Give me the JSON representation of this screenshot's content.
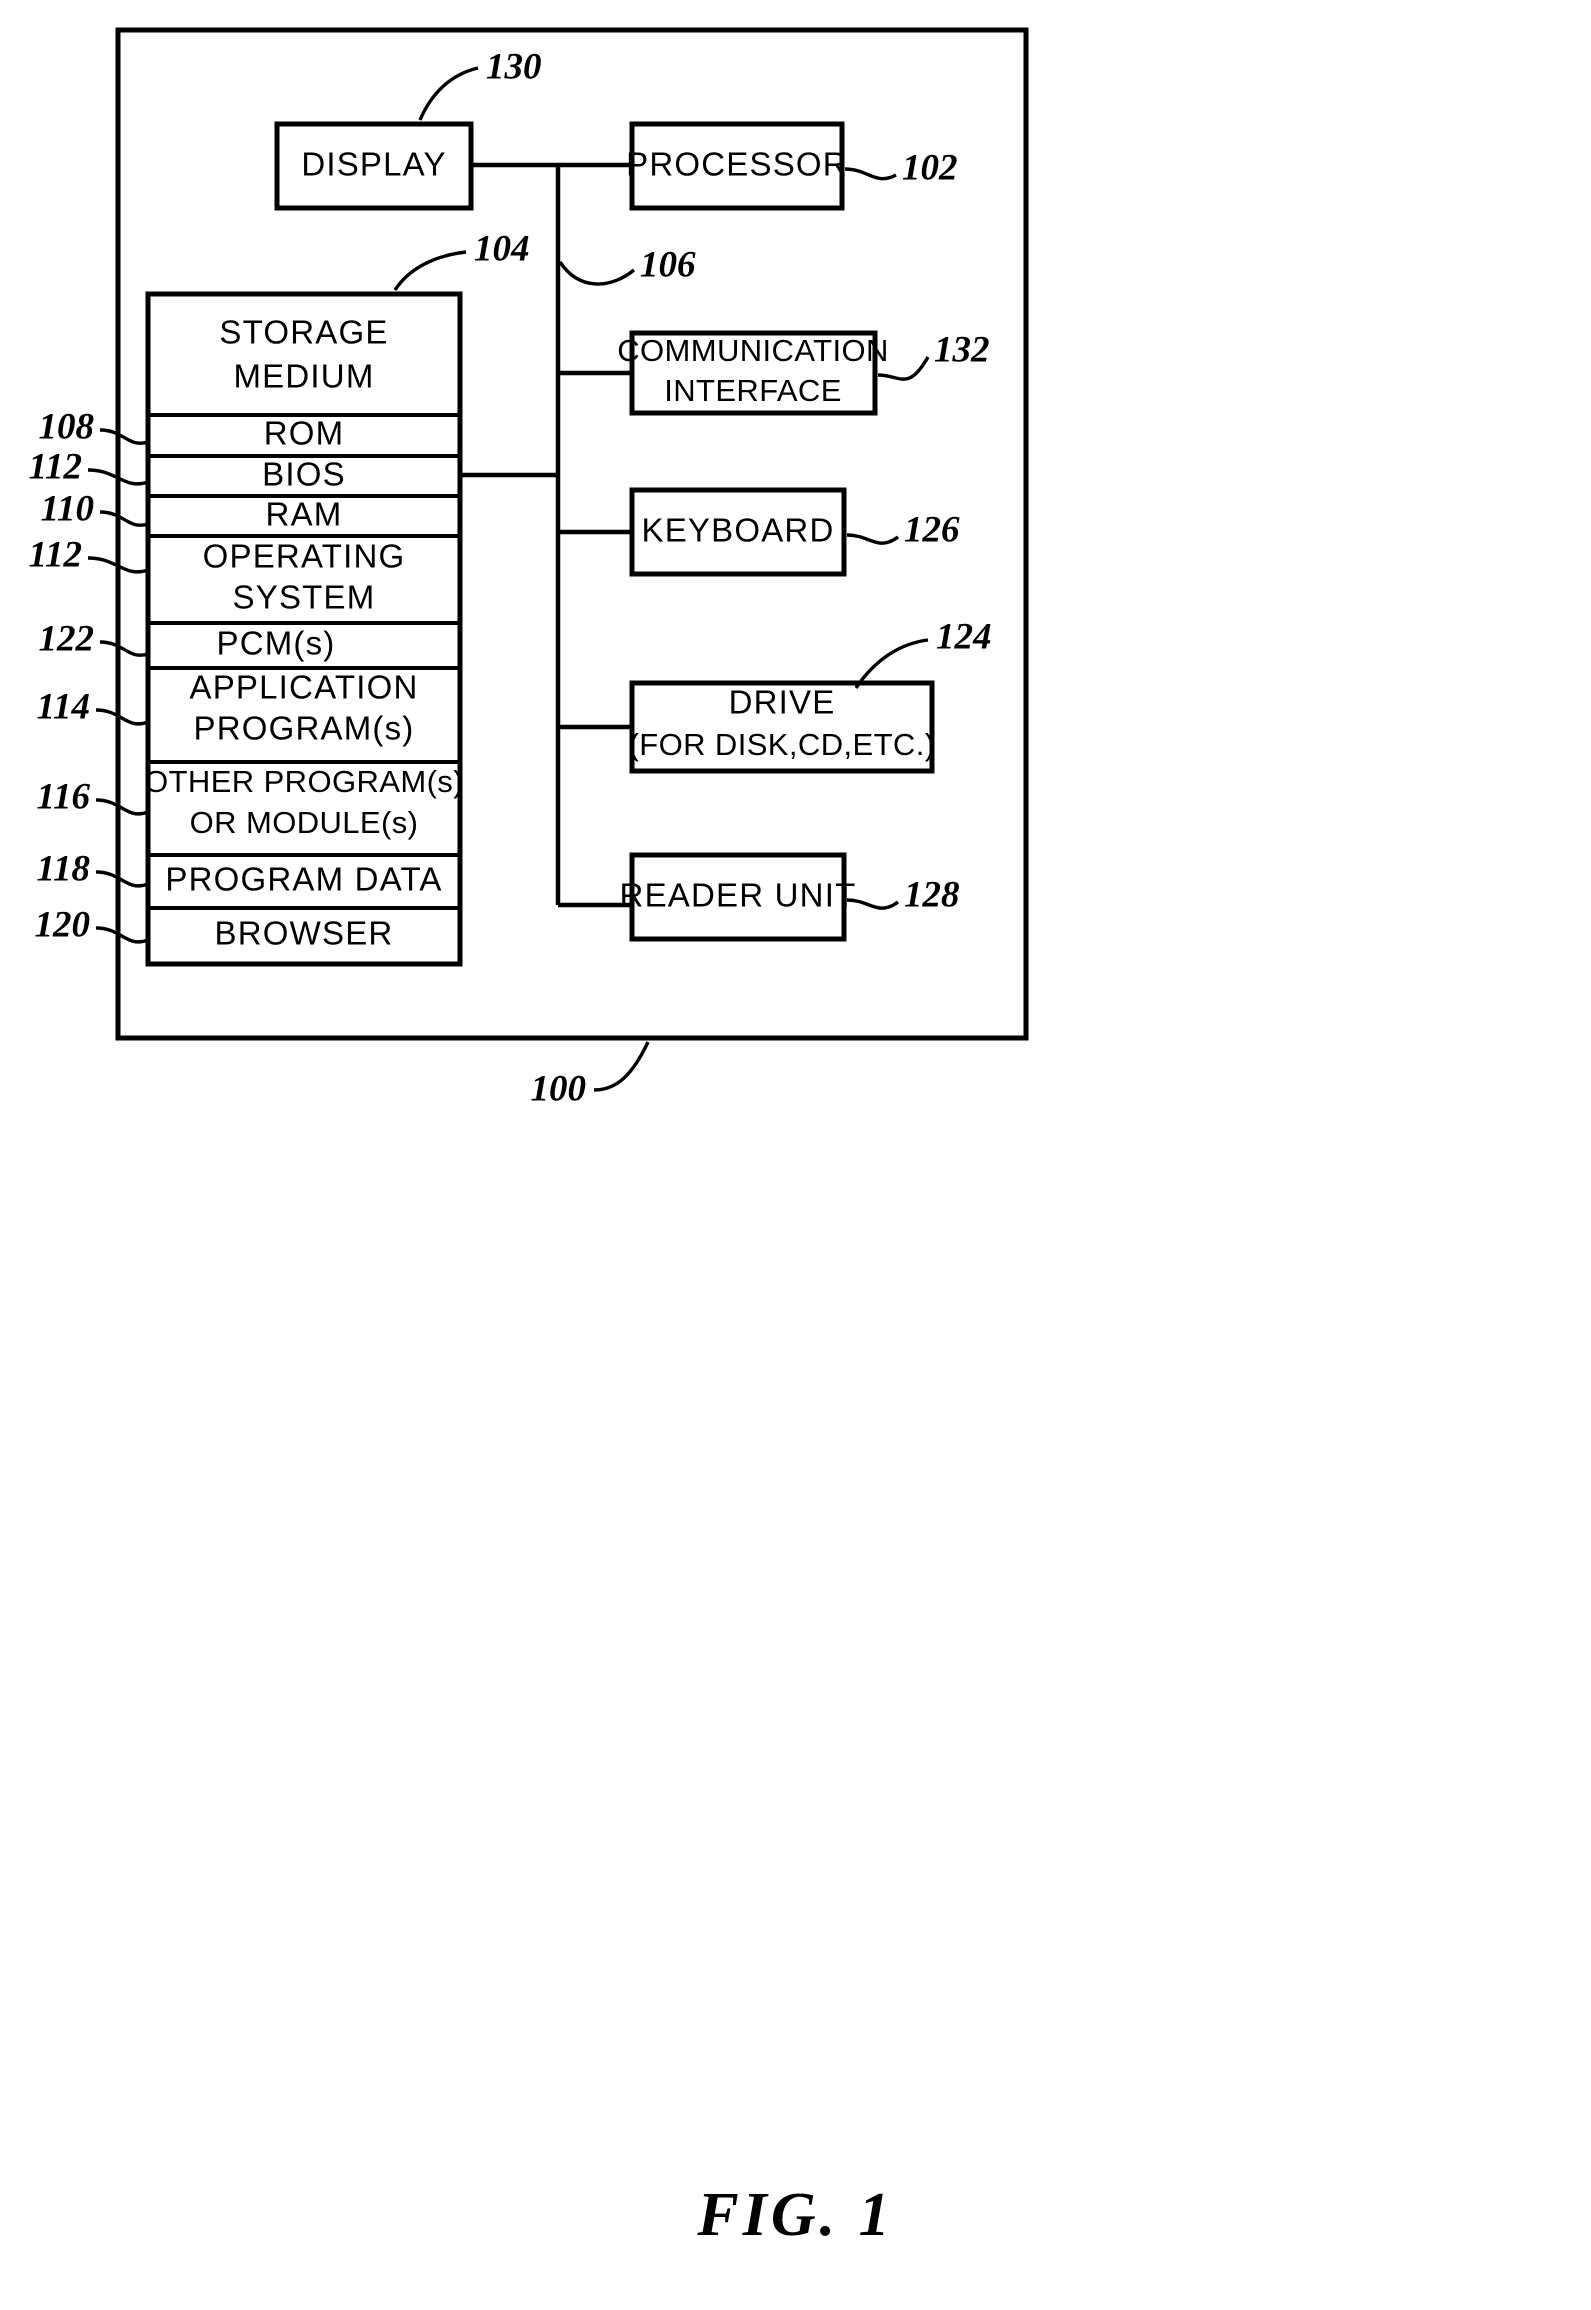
{
  "figure": {
    "caption": "FIG.  1",
    "system_ref": "100"
  },
  "boxes": {
    "display": {
      "label": "DISPLAY",
      "ref": "130"
    },
    "processor": {
      "label": "PROCESSOR",
      "ref": "102"
    },
    "communication_interface": {
      "line1": "COMMUNICATION",
      "line2": "INTERFACE",
      "ref": "132"
    },
    "keyboard": {
      "label": "KEYBOARD",
      "ref": "126"
    },
    "drive": {
      "line1": "DRIVE",
      "line2": "(FOR  DISK,CD,ETC.)",
      "ref": "124"
    },
    "reader_unit": {
      "label": "READER UNIT",
      "ref": "128"
    },
    "bus": {
      "ref": "106"
    }
  },
  "storage_medium": {
    "title_line1": "STORAGE",
    "title_line2": "MEDIUM",
    "ref": "104",
    "rows": [
      {
        "label": "ROM",
        "ref": "108",
        "lines": 1
      },
      {
        "label": "BIOS",
        "ref": "112",
        "lines": 1
      },
      {
        "label": "RAM",
        "ref": "110",
        "lines": 1
      },
      {
        "label": "OPERATING SYSTEM",
        "line1": "OPERATING",
        "line2": "SYSTEM",
        "ref": "112",
        "lines": 2
      },
      {
        "label": "PCM(s)",
        "ref": "122",
        "lines": 1
      },
      {
        "label": "APPLICATION PROGRAM(s)",
        "line1": "APPLICATION",
        "line2": "PROGRAM(s)",
        "ref": "114",
        "lines": 2
      },
      {
        "label": "OTHER PROGRAM(s) OR MODULE(s)",
        "line1": "OTHER  PROGRAM(s)",
        "line2": "OR  MODULE(s)",
        "ref": "116",
        "lines": 2
      },
      {
        "label": "PROGRAM  DATA",
        "ref": "118",
        "lines": 1
      },
      {
        "label": "BROWSER",
        "ref": "120",
        "lines": 1
      }
    ]
  }
}
